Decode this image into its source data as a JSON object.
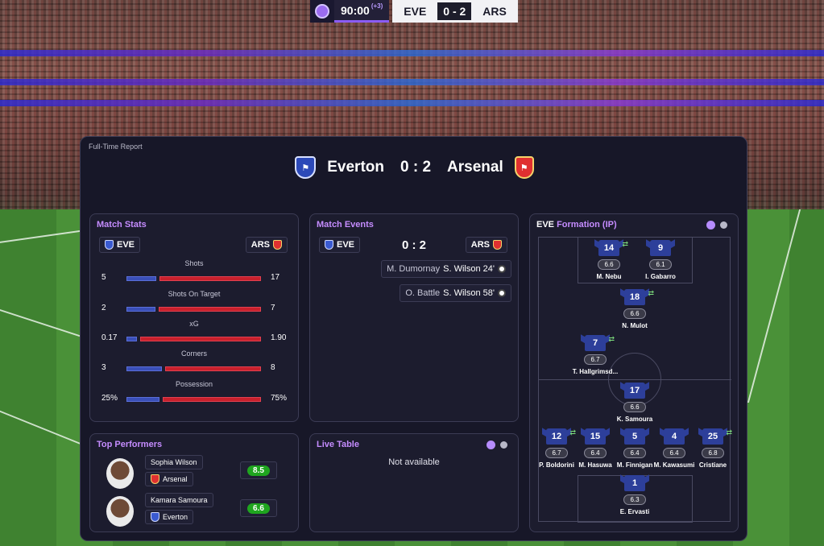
{
  "scorebug": {
    "time": "90:00",
    "added": "(+3)",
    "home": "EVE",
    "score": "0 - 2",
    "away": "ARS"
  },
  "report": {
    "title": "Full-Time Report",
    "home_name": "Everton",
    "score": "0 : 2",
    "away_name": "Arsenal"
  },
  "match_stats": {
    "title": "Match Stats",
    "home": "EVE",
    "away": "ARS",
    "stats": [
      {
        "label": "Shots",
        "home": "5",
        "away": "17",
        "home_frac": 0.227
      },
      {
        "label": "Shots On Target",
        "home": "2",
        "away": "7",
        "home_frac": 0.222
      },
      {
        "label": "xG",
        "home": "0.17",
        "away": "1.90",
        "home_frac": 0.082
      },
      {
        "label": "Corners",
        "home": "3",
        "away": "8",
        "home_frac": 0.273
      },
      {
        "label": "Possession",
        "home": "25%",
        "away": "75%",
        "home_frac": 0.25
      }
    ]
  },
  "match_events": {
    "title": "Match Events",
    "home": "EVE",
    "away": "ARS",
    "score": "0 : 2",
    "events": [
      {
        "assist": "M. Dumornay",
        "scorer": "S. Wilson 24'"
      },
      {
        "assist": "O. Battle",
        "scorer": "S. Wilson 58'"
      }
    ]
  },
  "formation": {
    "title_team": "EVE",
    "title_rest": "Formation (IP)",
    "players": [
      {
        "num": "14",
        "rating": "6.6",
        "name": "M. Nebu",
        "sub": true
      },
      {
        "num": "9",
        "rating": "6.1",
        "name": "I. Gabarro",
        "sub": false
      },
      {
        "num": "18",
        "rating": "6.6",
        "name": "N. Mulot",
        "sub": true
      },
      {
        "num": "7",
        "rating": "6.7",
        "name": "T. Hallgrimsd...",
        "sub": true
      },
      {
        "num": "17",
        "rating": "6.6",
        "name": "K. Samoura",
        "sub": false
      },
      {
        "num": "12",
        "rating": "6.7",
        "name": "P. Boldorini",
        "sub": true
      },
      {
        "num": "15",
        "rating": "6.4",
        "name": "M. Hasuwa",
        "sub": false
      },
      {
        "num": "5",
        "rating": "6.4",
        "name": "M. Finnigan",
        "sub": false
      },
      {
        "num": "4",
        "rating": "6.4",
        "name": "M. Kawasumi",
        "sub": false
      },
      {
        "num": "25",
        "rating": "6.8",
        "name": "Cristiane",
        "sub": true
      },
      {
        "num": "1",
        "rating": "6.3",
        "name": "E. Ervasti",
        "sub": false
      }
    ],
    "sub_icon": "substitution-arrows-icon"
  },
  "top_performers": {
    "title": "Top Performers",
    "players": [
      {
        "name": "Sophia Wilson",
        "club": "Arsenal",
        "rating": "8.5"
      },
      {
        "name": "Kamara Samoura",
        "club": "Everton",
        "rating": "6.6"
      }
    ]
  },
  "live_table": {
    "title": "Live Table",
    "message": "Not available"
  },
  "colors": {
    "accent": "#c58cff",
    "home_bar": "#3a4fb8",
    "away_bar": "#c8202c",
    "rating_green": "#1fa51f"
  }
}
